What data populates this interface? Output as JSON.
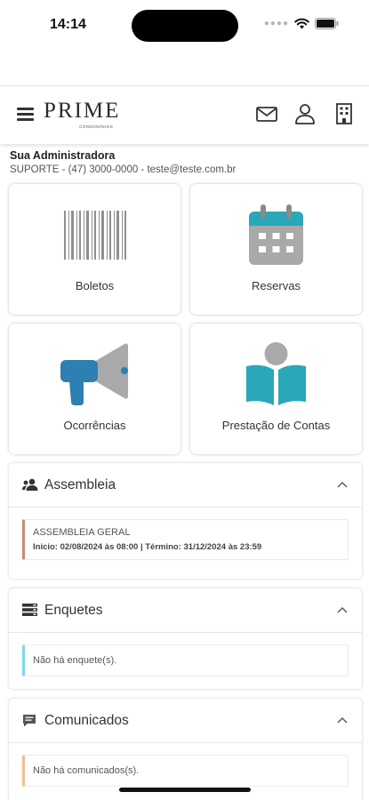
{
  "status": {
    "time": "14:14"
  },
  "header": {
    "logo_text": "PRIME",
    "logo_sub": "CONDOMÍNIOS",
    "icons": [
      "mail-icon",
      "user-icon",
      "building-icon"
    ]
  },
  "admin": {
    "title": "Sua Administradora",
    "contact": "SUPORTE - (47) 3000-0000 - teste@teste.com.br"
  },
  "tiles": [
    {
      "label": "Boletos",
      "icon": "barcode-icon"
    },
    {
      "label": "Reservas",
      "icon": "calendar-icon"
    },
    {
      "label": "Ocorrências",
      "icon": "megaphone-icon"
    },
    {
      "label": "Prestação de Contas",
      "icon": "reader-book-icon"
    }
  ],
  "assembleia": {
    "title": "Assembleia",
    "entry_title": "ASSEMBLEIA GERAL",
    "entry_sub": "Inicio: 02/08/2024 às 08:00 | Término: 31/12/2024 às 23:59",
    "accent": "#c88a77"
  },
  "enquetes": {
    "title": "Enquetes",
    "empty": "Não há enquete(s).",
    "accent": "#7fd8ec"
  },
  "comunicados": {
    "title": "Comunicados",
    "empty": "Não há comunicados(s).",
    "accent": "#f0c08e"
  },
  "colors": {
    "teal": "#2aa7b8",
    "blue": "#2e7fb2",
    "gray": "#a9a9a9"
  }
}
